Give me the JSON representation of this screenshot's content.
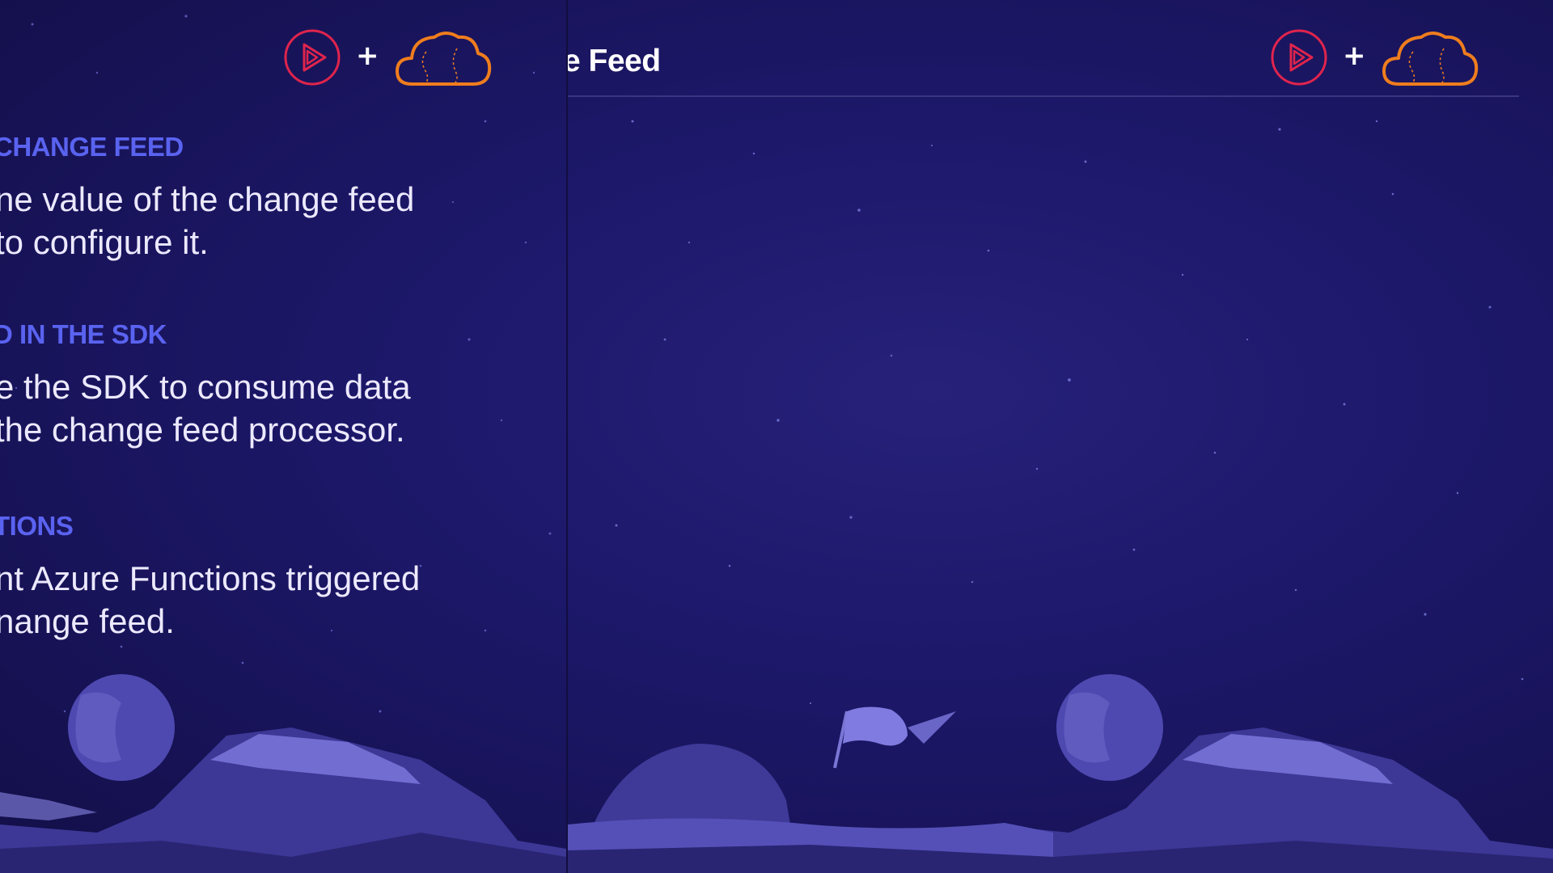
{
  "colors": {
    "background": "#1d186a",
    "heading_accent": "#5a63f0",
    "play_logo": "#e0244d",
    "cloud_logo": "#ef7d1e"
  },
  "icons": {
    "play_logo": "play-circle-icon",
    "cloud_logo": "cloud-brain-icon"
  },
  "left_slide": {
    "plus": "+",
    "sections": [
      {
        "heading": "CHANGE FEED",
        "lines": [
          "ne value of the change feed",
          " to configure it."
        ]
      },
      {
        "heading": "D IN THE SDK",
        "lines": [
          "e the SDK to consume data",
          "the change feed processor."
        ]
      },
      {
        "heading": "TIONS",
        "lines": [
          "nt Azure Functions triggered",
          "nange feed."
        ]
      }
    ]
  },
  "right_slide": {
    "title": "e Feed",
    "plus": "+"
  }
}
